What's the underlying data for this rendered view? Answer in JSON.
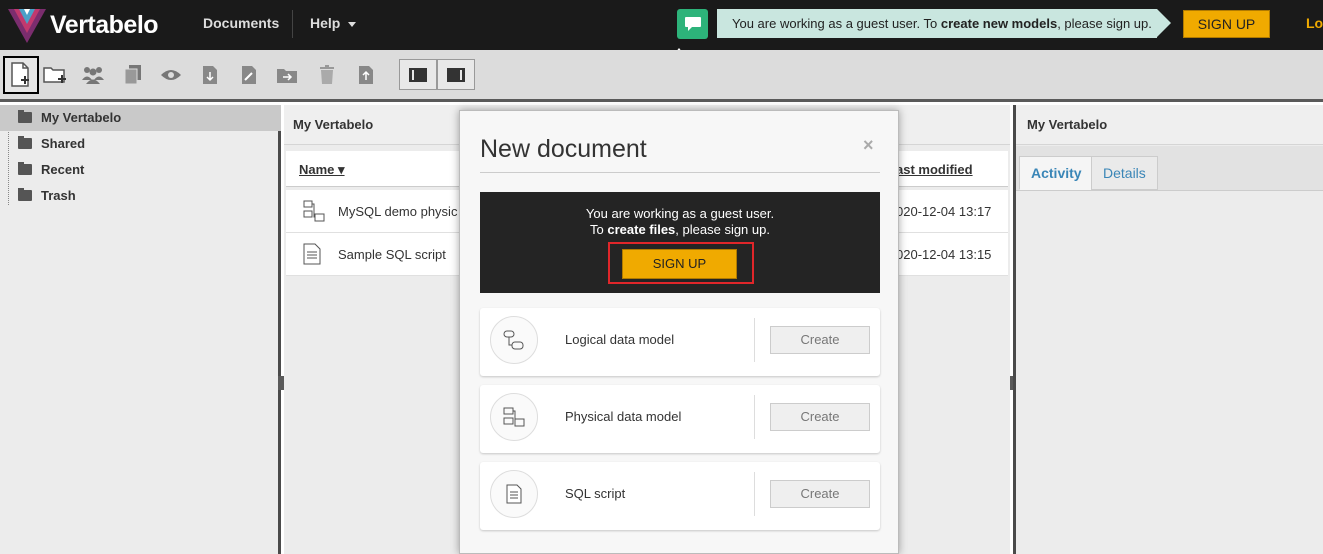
{
  "app": {
    "name": "Vertabelo",
    "nav": {
      "documents": "Documents",
      "help": "Help"
    },
    "guest_banner": {
      "pre": "You are working as a guest user. To ",
      "bold": "create new models",
      "post": ", please sign up."
    },
    "signup_label": "SIGN UP",
    "login_label": "Lo"
  },
  "tree": {
    "items": [
      {
        "label": "My Vertabelo",
        "selected": true
      },
      {
        "label": "Shared"
      },
      {
        "label": "Recent"
      },
      {
        "label": "Trash"
      }
    ]
  },
  "center": {
    "title": "My Vertabelo",
    "columns": {
      "name": "Name ▾",
      "modified": "ast modified"
    },
    "rows": [
      {
        "name": "MySQL demo physic",
        "modified": "020-12-04 13:17",
        "icon": "physical-model-icon"
      },
      {
        "name": "Sample SQL script",
        "modified": "020-12-04 13:15",
        "icon": "sql-script-icon"
      }
    ]
  },
  "right": {
    "title": "My Vertabelo",
    "tabs": [
      {
        "label": "Activity",
        "active": true
      },
      {
        "label": "Details"
      }
    ]
  },
  "modal": {
    "title": "New document",
    "close": "×",
    "guest_line1": "You are working as a guest user.",
    "guest_line2_pre": "To ",
    "guest_line2_bold": "create files",
    "guest_line2_post": ", please sign up.",
    "signup_label": "SIGN UP",
    "documents": [
      {
        "label": "Logical data model",
        "icon": "logical-model-icon",
        "button": "Create"
      },
      {
        "label": "Physical data model",
        "icon": "physical-model-icon",
        "button": "Create"
      },
      {
        "label": "SQL script",
        "icon": "sql-script-icon",
        "button": "Create"
      }
    ]
  },
  "colors": {
    "accent": "#f0aa00",
    "topbar": "#1a1a1a",
    "banner": "#c9e6df",
    "chat": "#2db37a",
    "link": "#3a86b7"
  }
}
